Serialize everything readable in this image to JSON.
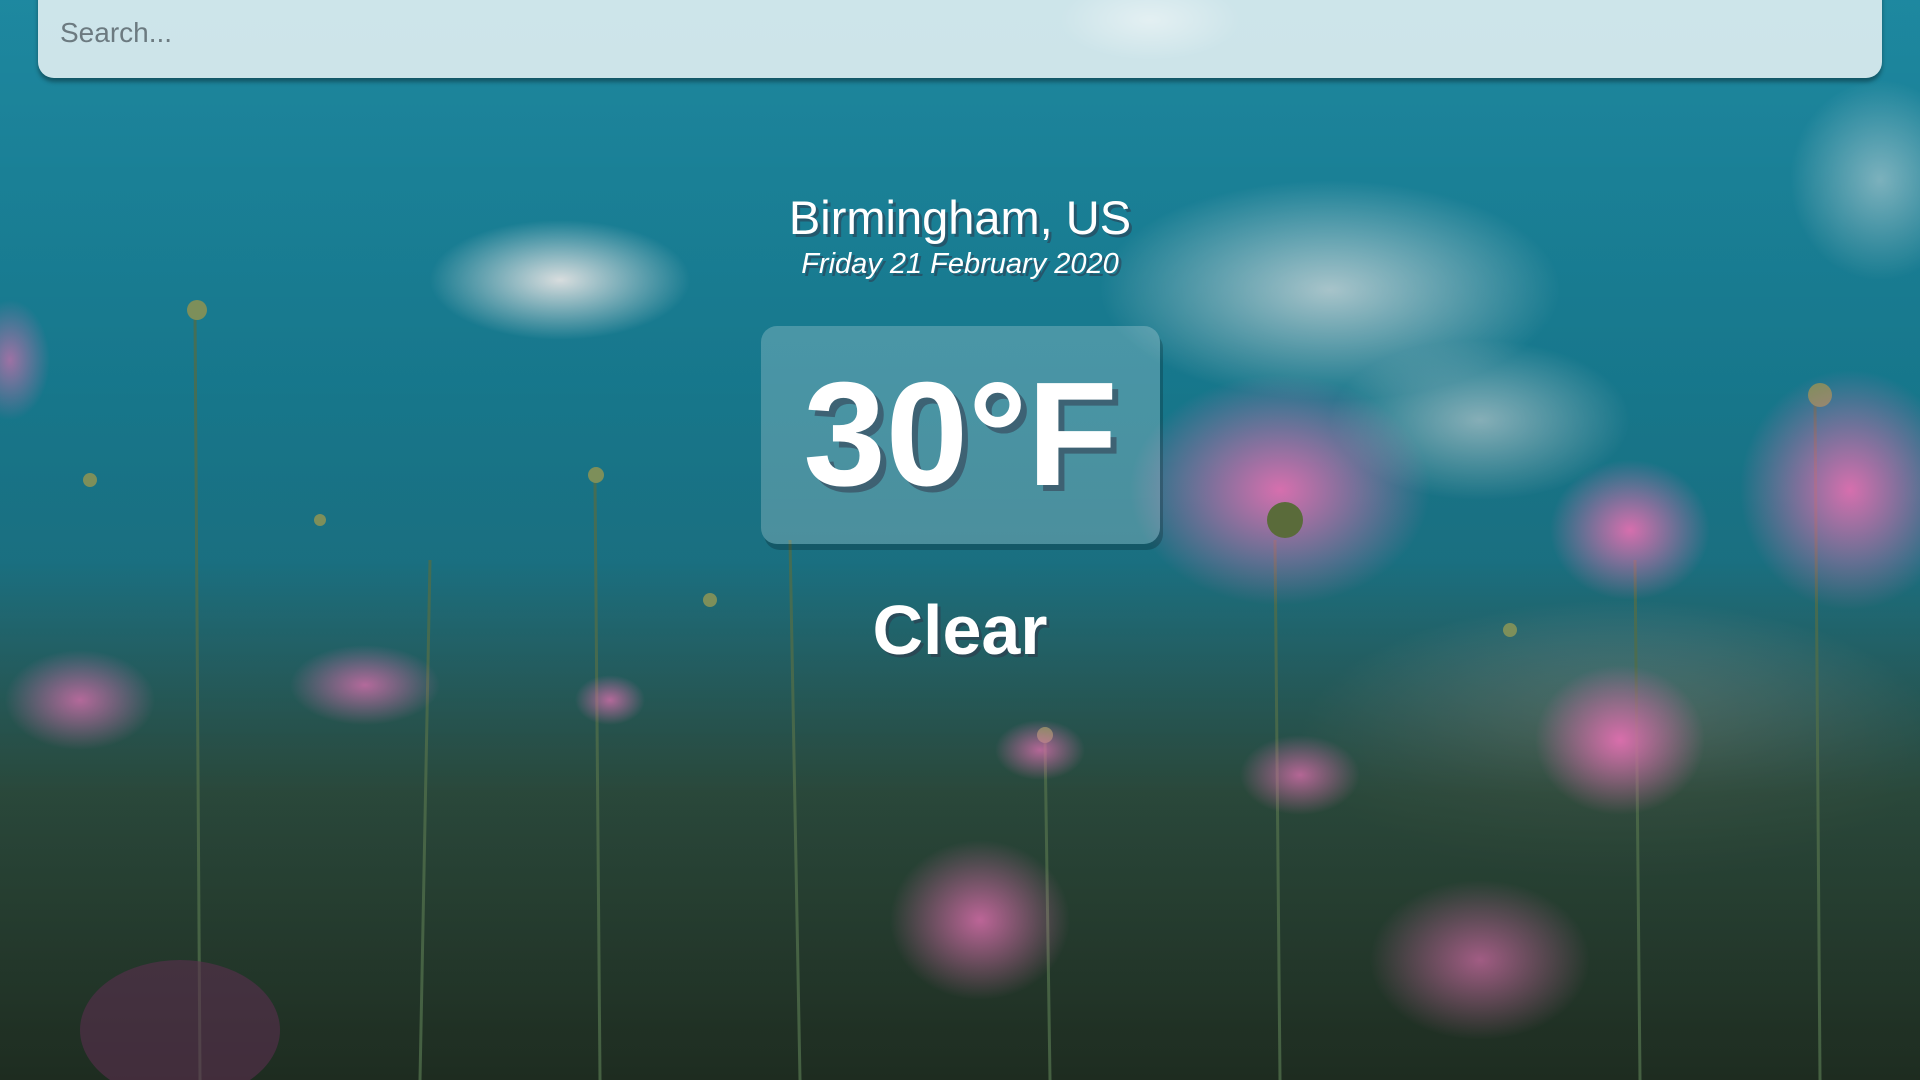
{
  "search": {
    "placeholder": "Search...",
    "value": ""
  },
  "location": {
    "name": "Birmingham, US",
    "date": "Friday 21 February 2020"
  },
  "weather": {
    "temperature": "30°F",
    "condition": "Clear"
  },
  "colors": {
    "sky": "#1f8fa8",
    "flower_pink": "#d66aa6",
    "foliage": "#3d5a3a",
    "text": "#ffffff"
  }
}
